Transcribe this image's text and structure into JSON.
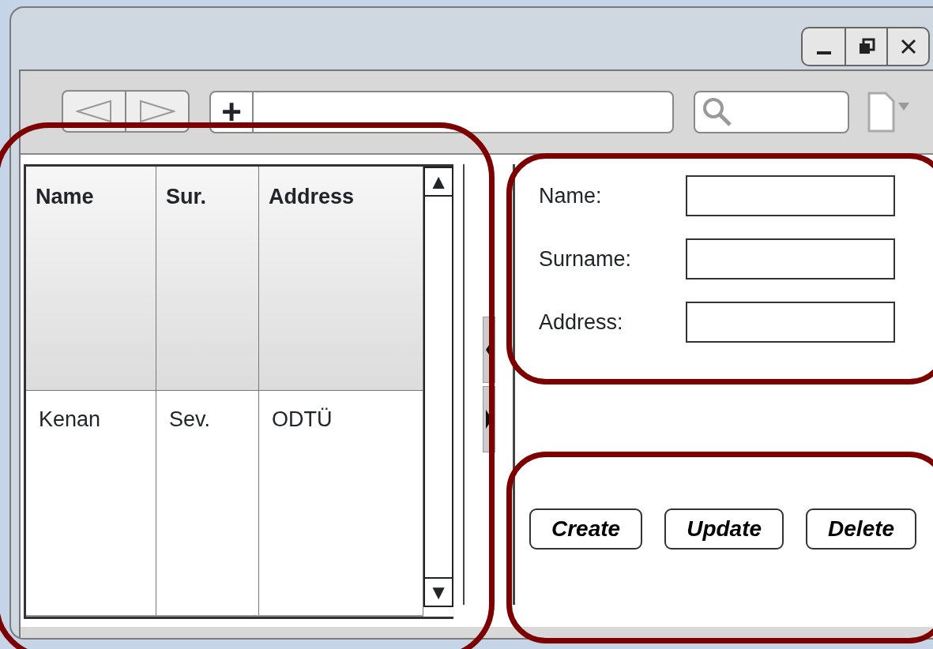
{
  "toolbar": {
    "add_button": "+"
  },
  "table": {
    "columns": [
      "Name",
      "Sur.",
      "Address"
    ],
    "rows": [
      [
        "Kenan",
        "Sev.",
        "ODTÜ"
      ]
    ],
    "scroll_up": "▲",
    "scroll_down": "▼"
  },
  "form": {
    "fields": [
      {
        "label": "Name:"
      },
      {
        "label": "Surname:"
      },
      {
        "label": "Address:"
      }
    ]
  },
  "buttons": [
    "Create",
    "Update",
    "Delete"
  ]
}
